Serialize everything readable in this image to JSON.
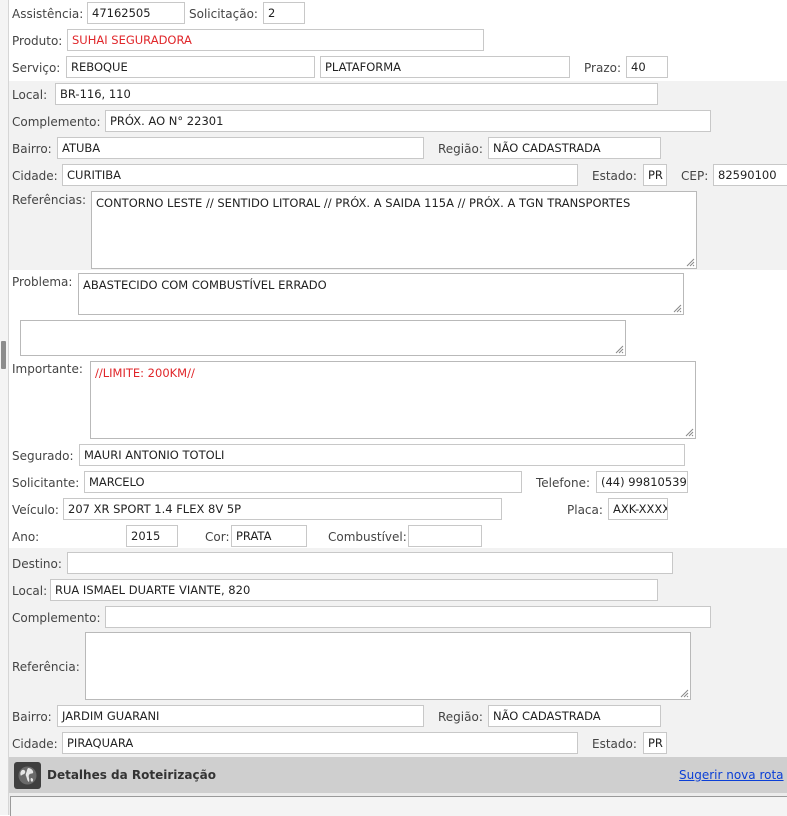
{
  "form": {
    "assistencia": {
      "label": "Assistência:",
      "value": "47162505"
    },
    "solicitacao": {
      "label": "Solicitação:",
      "value": "2"
    },
    "produto": {
      "label": "Produto:",
      "value": "SUHAI SEGURADORA"
    },
    "servico": {
      "label": "Serviço:",
      "value1": "REBOQUE",
      "value2": "PLATAFORMA"
    },
    "prazo": {
      "label": "Prazo:",
      "value": "40"
    },
    "local": {
      "label": "Local:",
      "value": "BR-116, 110"
    },
    "complemento": {
      "label": "Complemento:",
      "value": "PRÓX. AO N° 22301"
    },
    "bairro": {
      "label": "Bairro:",
      "value": "ATUBA"
    },
    "regiao": {
      "label": "Região:",
      "value": "NÃO CADASTRADA"
    },
    "cidade": {
      "label": "Cidade:",
      "value": "CURITIBA"
    },
    "estado": {
      "label": "Estado:",
      "value": "PR"
    },
    "cep": {
      "label": "CEP:",
      "value": "82590100"
    },
    "referencias": {
      "label": "Referências:",
      "value": "CONTORNO LESTE // SENTIDO LITORAL // PRÓX. A SAIDA 115A // PRÓX. A TGN TRANSPORTES"
    },
    "problema": {
      "label": "Problema:",
      "value": "ABASTECIDO COM COMBUSTÍVEL ERRADO",
      "extra": ""
    },
    "importante": {
      "label": "Importante:",
      "value": "//LIMITE: 200KM//"
    },
    "segurado": {
      "label": "Segurado:",
      "value": "MAURI ANTONIO TOTOLI"
    },
    "solicitante": {
      "label": "Solicitante:",
      "value": "MARCELO"
    },
    "telefone": {
      "label": "Telefone:",
      "value": "(44) 99810539("
    },
    "veiculo": {
      "label": "Veículo:",
      "value": "207 XR SPORT 1.4 FLEX 8V 5P"
    },
    "placa": {
      "label": "Placa:",
      "value": "AXK-XXXX"
    },
    "ano": {
      "label": "Ano:",
      "value": "2015"
    },
    "cor": {
      "label": "Cor:",
      "value": "PRATA"
    },
    "combustivel": {
      "label": "Combustível:",
      "value": ""
    }
  },
  "destino": {
    "destino": {
      "label": "Destino:",
      "value": ""
    },
    "local": {
      "label": "Local:",
      "value": "RUA ISMAEL DUARTE VIANTE, 820"
    },
    "complemento": {
      "label": "Complemento:",
      "value": ""
    },
    "referencia": {
      "label": "Referência:",
      "value": ""
    },
    "bairro": {
      "label": "Bairro:",
      "value": "JARDIM GUARANI"
    },
    "regiao": {
      "label": "Região:",
      "value": "NÃO CADASTRADA"
    },
    "cidade": {
      "label": "Cidade:",
      "value": "PIRAQUARA"
    },
    "estado": {
      "label": "Estado:",
      "value": "PR"
    }
  },
  "roteirizacao": {
    "title": "Detalhes da Roteirização",
    "link": "Sugerir nova rota"
  },
  "colors": {
    "red_text": "#e0262a",
    "link": "#0b3fd6",
    "band": "#f2f2f2",
    "header_bar": "#cfcfcf"
  },
  "icons": {
    "globe": "globe-icon",
    "resize": "resize-grip-icon"
  }
}
